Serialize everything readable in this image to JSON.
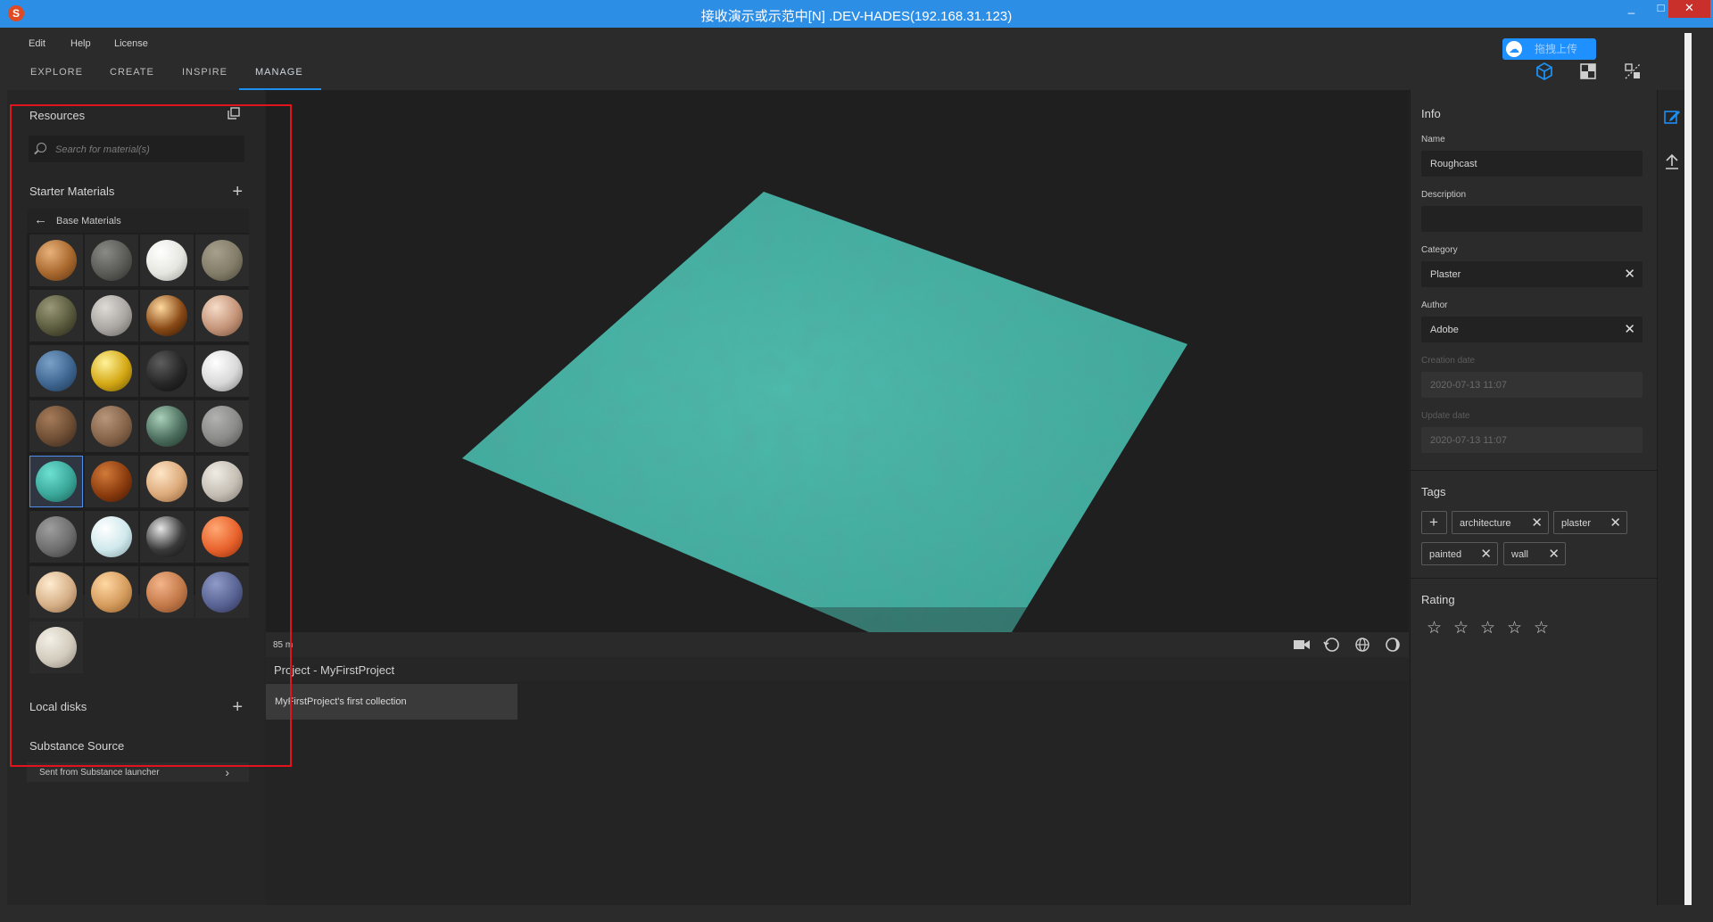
{
  "window": {
    "title": "接收演示或示范中[N] .DEV-HADES(192.168.31.123)",
    "app_icon": "substance-logo-icon",
    "controls": [
      "_",
      "□",
      "✕"
    ]
  },
  "menu": {
    "items": [
      "Edit",
      "Help",
      "License"
    ]
  },
  "cloud_button": {
    "label": "拖拽上传",
    "icon": "cloud-icon"
  },
  "tabs": [
    "EXPLORE",
    "CREATE",
    "INSPIRE",
    "MANAGE"
  ],
  "active_tab": "MANAGE",
  "toolbar_icons": [
    "cube-view-icon",
    "2d-view-icon",
    "split-view-icon"
  ],
  "sidebar": {
    "resources_title": "Resources",
    "search_placeholder": "Search for material(s)",
    "starter_title": "Starter Materials",
    "base_materials_label": "Base Materials",
    "local_disks_title": "Local disks",
    "substance_source_title": "Substance Source",
    "source_item": "Sent from Substance launcher",
    "source_chevron": "›"
  },
  "materials": [
    {
      "c1": "#e8b27a",
      "c2": "#a8682e",
      "c3": "#5a3312"
    },
    {
      "c1": "#8a8a86",
      "c2": "#5a5a56",
      "c3": "#2c2c2a"
    },
    {
      "c1": "#ffffff",
      "c2": "#e6e6e0",
      "c3": "#9a9a94"
    },
    {
      "c1": "#a6a08c",
      "c2": "#827c68",
      "c3": "#4a4638"
    },
    {
      "c1": "#9a9a78",
      "c2": "#5a5a3e",
      "c3": "#262618"
    },
    {
      "c1": "#dedad6",
      "c2": "#aaa6a2",
      "c3": "#625e5a"
    },
    {
      "c1": "#ffd9a0",
      "c2": "#8a4a16",
      "c3": "#2a1406"
    },
    {
      "c1": "#f6dcc8",
      "c2": "#c49478",
      "c3": "#6e4a36"
    },
    {
      "c1": "#7aa2c8",
      "c2": "#3e6690",
      "c3": "#1c3450"
    },
    {
      "c1": "#fff29a",
      "c2": "#d4a814",
      "c3": "#6e5206"
    },
    {
      "c1": "#5e5e5e",
      "c2": "#262626",
      "c3": "#0c0c0c"
    },
    {
      "c1": "#ffffff",
      "c2": "#d8d8d8",
      "c3": "#7a7a7a"
    },
    {
      "c1": "#a67c5a",
      "c2": "#6e4e34",
      "c3": "#34221a"
    },
    {
      "c1": "#b8967a",
      "c2": "#86644a",
      "c3": "#4c3624"
    },
    {
      "c1": "#a8d0b8",
      "c2": "#4c6e5e",
      "c3": "#1e3228"
    },
    {
      "c1": "#b2b2b0",
      "c2": "#8a8a88",
      "c3": "#4e4e4c"
    },
    {
      "c1": "#6ee0d2",
      "c2": "#3aa89a",
      "c3": "#1a5c54"
    },
    {
      "c1": "#d27a3a",
      "c2": "#8c3c0e",
      "c3": "#3e1604"
    },
    {
      "c1": "#ffe6c8",
      "c2": "#dcaa7a",
      "c3": "#8a5c36"
    },
    {
      "c1": "#f0ece4",
      "c2": "#c4beb4",
      "c3": "#7a746a"
    },
    {
      "c1": "#9e9e9e",
      "c2": "#6e6e6e",
      "c3": "#363636"
    },
    {
      "c1": "#ffffff",
      "c2": "#cfe8ec",
      "c3": "#7e9aa0"
    },
    {
      "c1": "#e6e6e6",
      "c2": "#3a3a3a",
      "c3": "#0e0e0e"
    },
    {
      "c1": "#ffa874",
      "c2": "#e8622c",
      "c3": "#8a2c0a"
    },
    {
      "c1": "#ffecd0",
      "c2": "#d6b088",
      "c3": "#8a643e"
    },
    {
      "c1": "#ffd8a2",
      "c2": "#d69c5e",
      "c3": "#8a5a26"
    },
    {
      "c1": "#f4b48a",
      "c2": "#c47a4a",
      "c3": "#7a4422"
    },
    {
      "c1": "#8e9ac8",
      "c2": "#5a6494",
      "c3": "#2a3052"
    },
    {
      "c1": "#f4f0e6",
      "c2": "#d2cbbd",
      "c3": "#8a8478"
    }
  ],
  "selected_material_index": 16,
  "viewport": {
    "status": "85 m",
    "bottom_icons": [
      "camera-icon",
      "rotate-env-icon",
      "globe-icon",
      "sphere-shading-icon"
    ]
  },
  "project": {
    "title": "Project - MyFirstProject",
    "collection": "MyFirstProject's first collection"
  },
  "info": {
    "title": "Info",
    "name_label": "Name",
    "name_value": "Roughcast",
    "description_label": "Description",
    "description_value": "",
    "category_label": "Category",
    "category_value": "Plaster",
    "author_label": "Author",
    "author_value": "Adobe",
    "creation_label": "Creation date",
    "creation_value": "2020-07-13 11:07",
    "update_label": "Update date",
    "update_value": "2020-07-13 11:07",
    "clear_glyph": "✕"
  },
  "tags": {
    "title": "Tags",
    "add_glyph": "+",
    "items": [
      "architecture",
      "plaster",
      "painted",
      "wall"
    ]
  },
  "rating": {
    "title": "Rating",
    "value": 0,
    "max": 5,
    "star_glyph": "☆"
  },
  "right_icons": [
    "edit-icon",
    "upload-icon"
  ],
  "colors": {
    "accent": "#1d8ff0",
    "highlight_box": "#e1141b",
    "plane": "#45b3a6",
    "titlebar": "#2d8ee6"
  }
}
